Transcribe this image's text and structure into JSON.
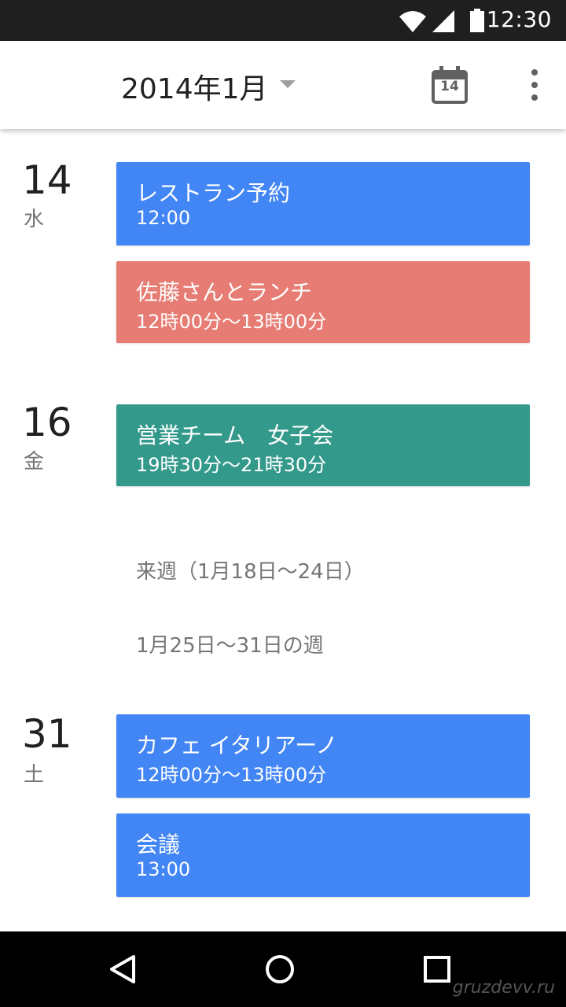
{
  "status_bar": {
    "time": "12:30",
    "icons": [
      "wifi-icon",
      "signal-icon",
      "battery-icon"
    ]
  },
  "app_bar": {
    "month_title": "2014年1月",
    "today_icon_day": "14"
  },
  "days": [
    {
      "day": "14",
      "weekday": "水",
      "events": [
        {
          "title": "レストラン予約",
          "time": "12:00",
          "color": "#4285f4"
        },
        {
          "title": "佐藤さんとランチ",
          "time": "12時00分～13時00分",
          "color": "#e67c73"
        }
      ]
    },
    {
      "day": "16",
      "weekday": "金",
      "events": [
        {
          "title": "営業チーム　女子会",
          "time": "19時30分～21時30分",
          "color": "#33998a"
        }
      ]
    },
    {
      "day": "31",
      "weekday": "土",
      "events": [
        {
          "title": "カフェ イタリアーノ",
          "time": "12時00分～13時00分",
          "color": "#4285f4"
        },
        {
          "title": "会議",
          "time": "13:00",
          "color": "#4285f4"
        }
      ]
    }
  ],
  "week_labels": [
    "来週（1月18日～24日）",
    "1月25日～31日の週"
  ],
  "watermark": "gruzdevv.ru"
}
